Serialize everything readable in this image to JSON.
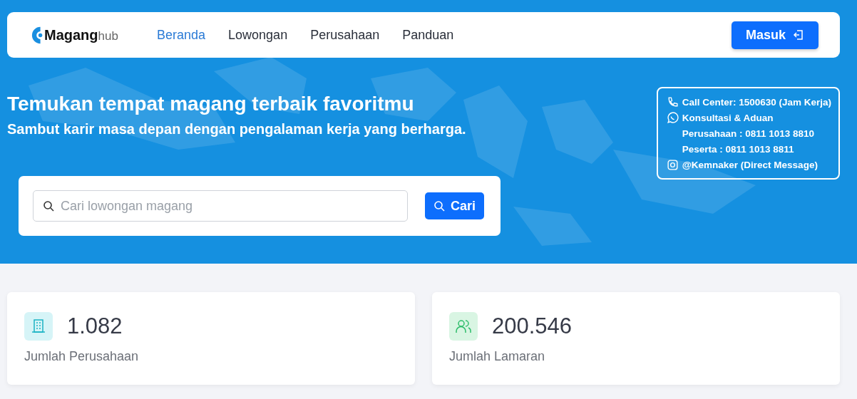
{
  "navbar": {
    "logo": {
      "main": "Magang",
      "suffix": "hub"
    },
    "links": [
      {
        "label": "Beranda",
        "selected": true
      },
      {
        "label": "Lowongan",
        "selected": false
      },
      {
        "label": "Perusahaan",
        "selected": false
      },
      {
        "label": "Panduan",
        "selected": false
      }
    ],
    "login_button": "Masuk"
  },
  "hero": {
    "title": "Temukan tempat magang terbaik favoritmu",
    "subtitle": "Sambut karir masa depan dengan pengalaman kerja yang berharga.",
    "contact": [
      {
        "kind": "phone",
        "text": "Call Center: 1500630 (Jam Kerja)"
      },
      {
        "kind": "whatsapp",
        "text": "Konsultasi & Aduan"
      },
      {
        "kind": "none",
        "text": "Perusahaan : 0811 1013 8810"
      },
      {
        "kind": "none",
        "text": "Peserta : 0811 1013 8811"
      },
      {
        "kind": "instagram",
        "text": "@Kemnaker (Direct Message)"
      }
    ],
    "search": {
      "placeholder": "Cari lowongan magang",
      "button": "Cari"
    }
  },
  "stats": [
    {
      "kind": "building",
      "value": "1.082",
      "label": "Jumlah Perusahaan"
    },
    {
      "kind": "people",
      "value": "200.546",
      "label": "Jumlah Lamaran"
    }
  ]
}
